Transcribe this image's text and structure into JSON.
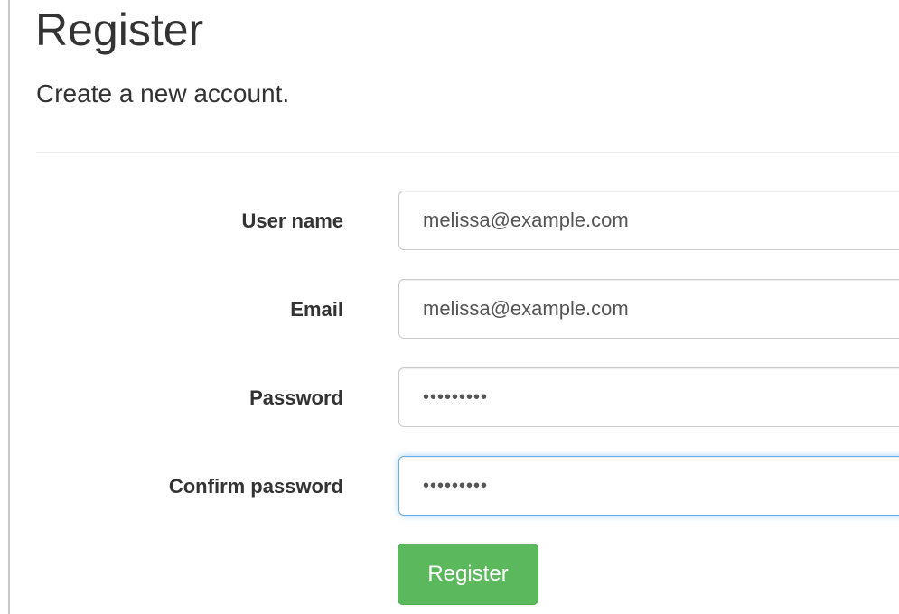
{
  "header": {
    "title": "Register",
    "subtitle": "Create a new account."
  },
  "form": {
    "username": {
      "label": "User name",
      "value": "melissa@example.com"
    },
    "email": {
      "label": "Email",
      "value": "melissa@example.com"
    },
    "password": {
      "label": "Password",
      "value": "•••••••••"
    },
    "confirm_password": {
      "label": "Confirm password",
      "value": "•••••••••"
    },
    "submit_label": "Register"
  },
  "colors": {
    "primary_button": "#5cb85c",
    "focus_ring": "#66afe9",
    "text": "#333333"
  }
}
